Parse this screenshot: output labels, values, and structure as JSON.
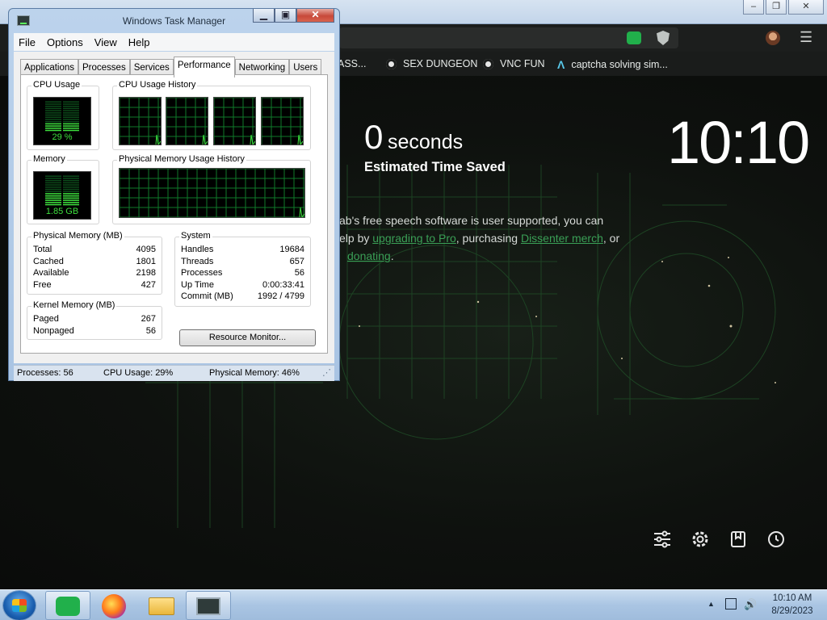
{
  "browser": {
    "bookmarks": [
      {
        "label": "ASS..."
      },
      {
        "label": "SEX DUNGEON",
        "icon": "gear-icon"
      },
      {
        "label": "VNC FUN",
        "icon": "gear-icon"
      },
      {
        "label": "captcha solving sim...",
        "icon": "triangle-logo-icon"
      }
    ],
    "window_controls": [
      "minimize",
      "restore",
      "close"
    ]
  },
  "new_tab": {
    "time_saved_value": "0",
    "time_saved_unit": "seconds",
    "time_saved_label": "Estimated Time Saved",
    "clock": "10:10",
    "promo_part1": "ab's free speech software is user supported, you can",
    "promo_part2": "elp by ",
    "promo_link1": "upgrading to Pro",
    "promo_part3": ", purchasing ",
    "promo_link2": "Dissenter merch",
    "promo_part4": ", or",
    "promo_link3": "donating",
    "promo_part5": ".",
    "bottom_icons": [
      "sliders-icon",
      "gear-icon",
      "bookmark-icon",
      "history-icon"
    ]
  },
  "task_manager": {
    "title": "Windows Task Manager",
    "menu": [
      "File",
      "Options",
      "View",
      "Help"
    ],
    "tabs": [
      "Applications",
      "Processes",
      "Services",
      "Performance",
      "Networking",
      "Users"
    ],
    "active_tab": "Performance",
    "cpu_usage_label": "CPU Usage",
    "cpu_usage_value": "29 %",
    "cpu_usage_fraction": 0.29,
    "cpu_history_label": "CPU Usage History",
    "memory_label": "Memory",
    "memory_value": "1.85 GB",
    "memory_fraction": 0.46,
    "phys_history_label": "Physical Memory Usage History",
    "physical_memory": {
      "label": "Physical Memory (MB)",
      "rows": [
        {
          "name": "Total",
          "value": "4095"
        },
        {
          "name": "Cached",
          "value": "1801"
        },
        {
          "name": "Available",
          "value": "2198"
        },
        {
          "name": "Free",
          "value": "427"
        }
      ]
    },
    "kernel_memory": {
      "label": "Kernel Memory (MB)",
      "rows": [
        {
          "name": "Paged",
          "value": "267"
        },
        {
          "name": "Nonpaged",
          "value": "56"
        }
      ]
    },
    "system": {
      "label": "System",
      "rows": [
        {
          "name": "Handles",
          "value": "19684"
        },
        {
          "name": "Threads",
          "value": "657"
        },
        {
          "name": "Processes",
          "value": "56"
        },
        {
          "name": "Up Time",
          "value": "0:00:33:41"
        },
        {
          "name": "Commit (MB)",
          "value": "1992 / 4799"
        }
      ]
    },
    "resource_monitor_button": "Resource Monitor...",
    "status": {
      "processes": "Processes: 56",
      "cpu": "CPU Usage: 29%",
      "memory": "Physical Memory: 46%"
    }
  },
  "taskbar": {
    "apps": [
      "gab-dissenter-app",
      "firefox-icon",
      "file-explorer-icon",
      "task-manager-icon"
    ],
    "time": "10:10 AM",
    "date": "8/29/2023"
  },
  "colors": {
    "graph_green": "#3ee03e",
    "grid_green": "#0f7a2a",
    "link_green": "#3a9f56"
  }
}
